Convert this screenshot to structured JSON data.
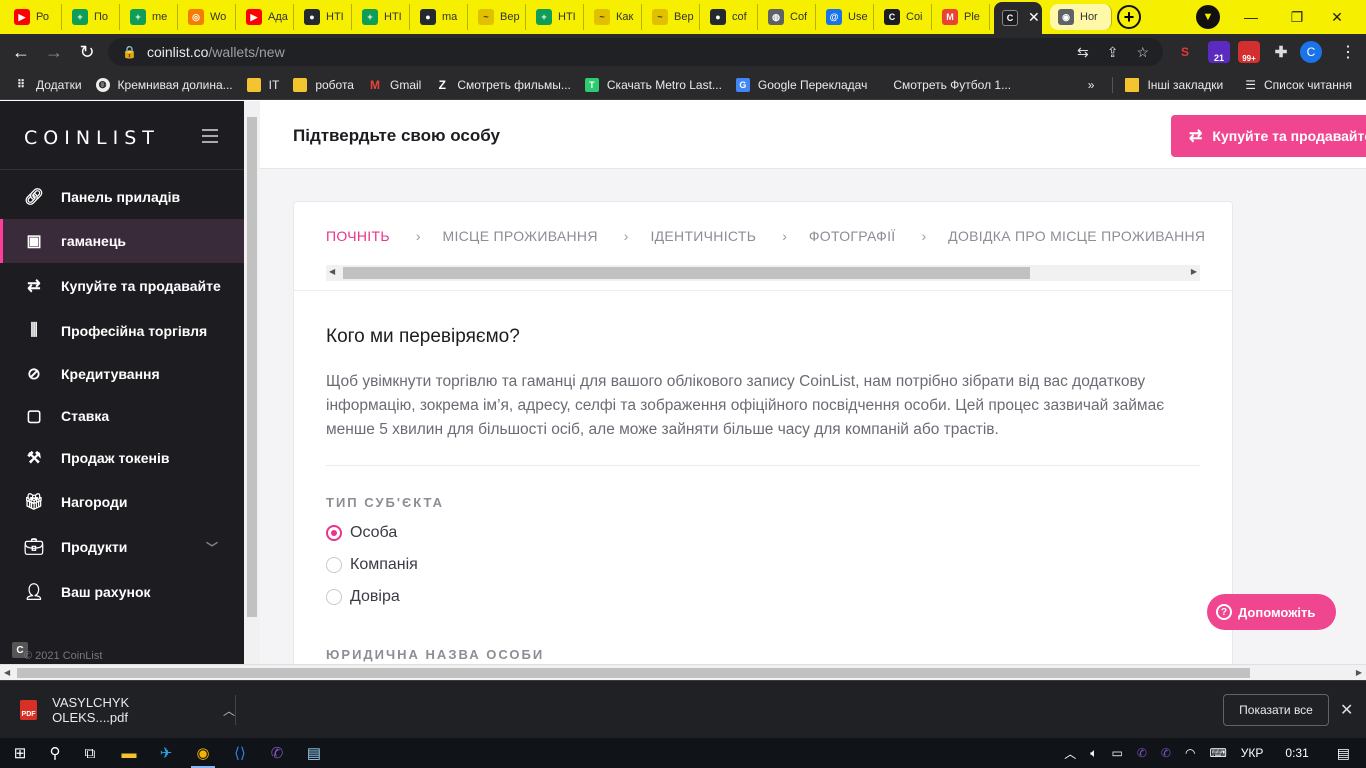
{
  "browser": {
    "tabs": [
      {
        "title": "Ро",
        "icon": "youtube-icon",
        "color": "#ff0000"
      },
      {
        "title": "По",
        "icon": "sheets-icon",
        "color": "#0f9d58"
      },
      {
        "title": "me",
        "icon": "sheets-icon",
        "color": "#0f9d58"
      },
      {
        "title": "Wo",
        "icon": "target-icon",
        "color": "#f57c00"
      },
      {
        "title": "Ада",
        "icon": "youtube-icon",
        "color": "#ff0000"
      },
      {
        "title": "НТІ",
        "icon": "github-icon",
        "color": "#24292e"
      },
      {
        "title": "НТІ",
        "icon": "sheets-icon",
        "color": "#0f9d58"
      },
      {
        "title": "ma",
        "icon": "github-icon",
        "color": "#24292e"
      },
      {
        "title": "Вер",
        "icon": "wave-icon",
        "color": "#e0c000"
      },
      {
        "title": "НТІ",
        "icon": "sheets-icon",
        "color": "#0f9d58"
      },
      {
        "title": "Как",
        "icon": "wave-icon",
        "color": "#e0c000"
      },
      {
        "title": "Вер",
        "icon": "wave-icon",
        "color": "#e0c000"
      },
      {
        "title": "cof",
        "icon": "github-icon",
        "color": "#24292e"
      },
      {
        "title": "Cof",
        "icon": "globe-icon",
        "color": "#5f6368"
      },
      {
        "title": "Use",
        "icon": "at-icon",
        "color": "#1a73e8"
      },
      {
        "title": "Coi",
        "icon": "coinlist-icon",
        "color": "#1d1d21"
      },
      {
        "title": "Ple",
        "icon": "gmail-icon",
        "color": "#ea4335"
      },
      {
        "title": "",
        "icon": "coinlist-icon",
        "color": "#1d1d21"
      },
      {
        "title": "Hor",
        "icon": "chrome-icon",
        "color": "#5f6368"
      }
    ],
    "url_host": "coinlist.co",
    "url_path": "/wallets/new",
    "profile_initial": "C",
    "ext_badge_purple": "21",
    "ext_badge_red": "99+"
  },
  "bookmarks": {
    "items": [
      {
        "label": "Додатки",
        "icon": "apps-icon"
      },
      {
        "label": "Кремнивая долина...",
        "icon": "globe-icon"
      },
      {
        "label": "IT",
        "icon": "folder-icon"
      },
      {
        "label": "робота",
        "icon": "folder-icon"
      },
      {
        "label": "Gmail",
        "icon": "gmail-icon"
      },
      {
        "label": "Смотреть фильмы...",
        "icon": "z-icon"
      },
      {
        "label": "Скачать Metro Last...",
        "icon": "t-icon"
      },
      {
        "label": "Google Перекладач",
        "icon": "translate-icon"
      },
      {
        "label": "Смотреть Футбол 1...",
        "icon": "blank-icon"
      }
    ],
    "more": "»",
    "other": "Інші закладки",
    "reading_list": "Список читання"
  },
  "sidebar": {
    "logo": "COINLIST",
    "items": [
      {
        "label": "Панель приладів",
        "icon": "link-icon"
      },
      {
        "label": "гаманець",
        "icon": "wallet-icon"
      },
      {
        "label": "Купуйте та продавайте",
        "icon": "exchange-icon"
      },
      {
        "label": "Професійна торгівля",
        "icon": "candlestick-icon"
      },
      {
        "label": "Кредитування",
        "icon": "lending-icon"
      },
      {
        "label": "Ставка",
        "icon": "stake-icon"
      },
      {
        "label": "Продаж токенів",
        "icon": "gavel-icon"
      },
      {
        "label": "Нагороди",
        "icon": "gift-icon"
      },
      {
        "label": "Продукти",
        "icon": "briefcase-icon"
      },
      {
        "label": "Ваш рахунок",
        "icon": "user-icon"
      }
    ],
    "copyright": "© 2021 CoinList"
  },
  "header": {
    "title": "Підтвердьте свою особу",
    "buy_sell": "Купуйте та продавайте"
  },
  "steps": [
    "ПОЧНІТЬ",
    "МІСЦЕ ПРОЖИВАННЯ",
    "ІДЕНТИЧНІСТЬ",
    "ФОТОГРАФІЇ",
    "ДОВІДКА ПРО МІСЦЕ ПРОЖИВАННЯ"
  ],
  "form": {
    "question": "Кого ми перевіряємо?",
    "description": "Щоб увімкнути торгівлю та гаманці для вашого облікового запису CoinList, нам потрібно зібрати від вас додаткову інформацію, зокрема ім’я, адресу, селфі та зображення офіційного посвідчення особи. Цей процес зазвичай займає менше 5 хвилин для більшості осіб, але може зайняти більше часу для компаній або трастів.",
    "entity_type_label": "ТИП СУБ'ЄКТА",
    "options": [
      "Особа",
      "Компанія",
      "Довіра"
    ],
    "selected": "Особа",
    "legal_name_label": "ЮРИДИЧНА НАЗВА ОСОБИ"
  },
  "help_button": "Допоможіть",
  "downloads": {
    "file": "VASYLCHYK OLEKS....pdf",
    "show_all": "Показати все"
  },
  "taskbar": {
    "lang": "УКР",
    "time": "0:31"
  },
  "colors": {
    "accent": "#f0458f",
    "sidebar": "#1d1d21",
    "browser_frame": "#f6ef00"
  }
}
